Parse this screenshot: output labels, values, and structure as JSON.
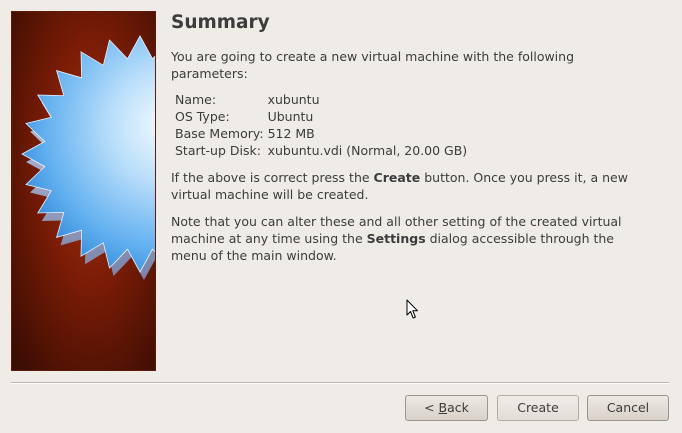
{
  "page": {
    "title": "Summary",
    "intro": "You are going to create a new virtual machine with the following parameters:",
    "parameters": [
      {
        "key": "Name:",
        "value": "xubuntu"
      },
      {
        "key": "OS Type:",
        "value": "Ubuntu"
      },
      {
        "key": "Base Memory:",
        "value": "512 MB"
      },
      {
        "key": "Start-up Disk:",
        "value": "xubuntu.vdi (Normal, 20.00 GB)"
      }
    ],
    "confirm_text_pre": "If the above is correct press the ",
    "confirm_text_bold": "Create",
    "confirm_text_post": " button. Once you press it, a new virtual machine will be created.",
    "note_text_pre": "Note that you can alter these and all other setting of the created virtual machine at any time using the ",
    "note_text_bold": "Settings",
    "note_text_post": " dialog accessible through the menu of the main window."
  },
  "buttons": {
    "back_prefix": "< ",
    "back_mnemonic": "B",
    "back_rest": "ack",
    "create": "Create",
    "cancel": "Cancel"
  },
  "colors": {
    "banner_dark": "#3b0d03",
    "banner_light": "#a8300f",
    "star_light": "#e9f6ff",
    "star_blue": "#4aa2ec",
    "window_bg": "#efebe7"
  },
  "icons": {
    "banner": "virtualbox-star-banner",
    "cursor": "mouse-pointer-icon"
  }
}
